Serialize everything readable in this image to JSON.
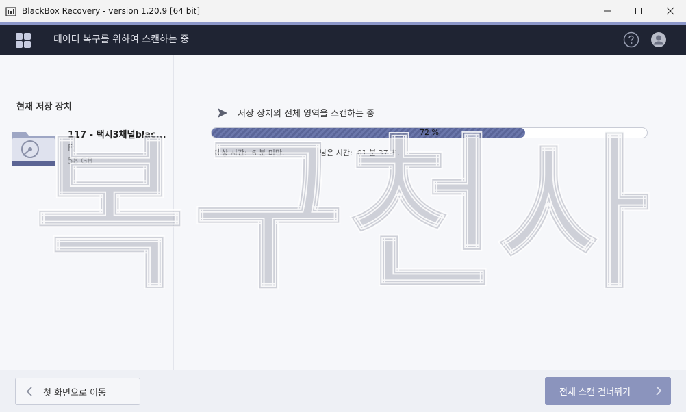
{
  "window": {
    "title": "BlackBox Recovery - version 1.20.9 [64 bit]"
  },
  "header": {
    "title": "데이터 복구를 위하여 스캔하는 중",
    "menu_icon": "grid-menu-icon",
    "help_icon": "help-icon",
    "user_icon": "user-avatar-icon"
  },
  "left_panel": {
    "section_title": "현재 저장 장치",
    "drive": {
      "name": "117 - 택시3채널blac...",
      "letter": "F:",
      "size": "58 GB",
      "icon": "hard-drive-icon"
    }
  },
  "scan": {
    "title": "저장 장치의 전체 영역을 스캔하는 중",
    "progress_percent": 72,
    "progress_label": "72 %",
    "estimated_label": "예상 시간:",
    "estimated_value": "6 분 미만.",
    "remaining_label": "남은 시간:",
    "remaining_value": "01 분 37 초."
  },
  "watermark": {
    "chars": [
      "복",
      "구",
      "천",
      "사"
    ]
  },
  "footer": {
    "back_label": "첫 화면으로 이동",
    "skip_label": "전체 스캔 건너뛰기"
  },
  "colors": {
    "accent": "#8c97c9",
    "header_bg": "#1f2433",
    "progress_fill": "#5a6598",
    "skip_button": "#8b94bd"
  }
}
